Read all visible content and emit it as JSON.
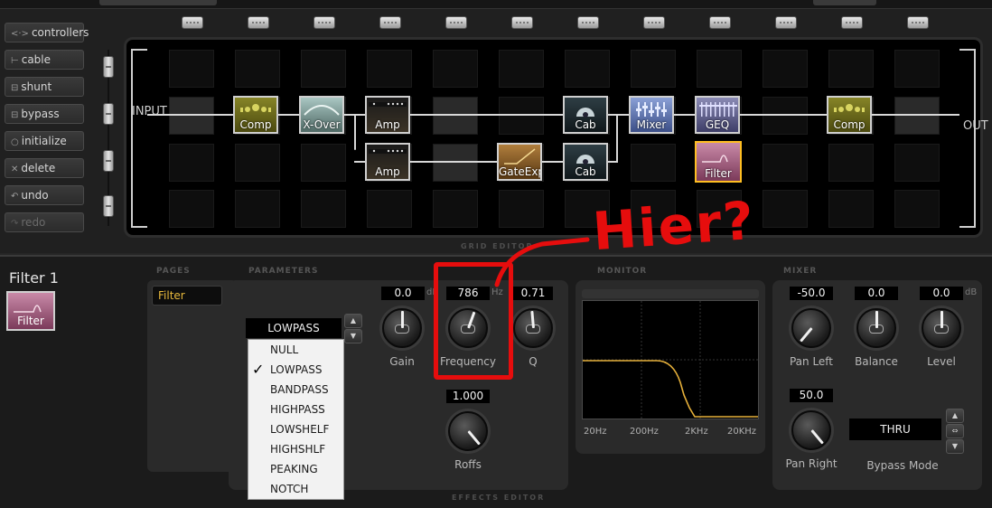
{
  "sidebar": {
    "buttons": [
      {
        "icon": "arrows-icon",
        "glyph": "<·>",
        "label": "controllers"
      },
      {
        "icon": "cable-icon",
        "glyph": "⊢",
        "label": "cable"
      },
      {
        "icon": "shunt-icon",
        "glyph": "⊟",
        "label": "shunt"
      },
      {
        "icon": "bypass-icon",
        "glyph": "⊟",
        "label": "bypass"
      },
      {
        "icon": "initialize-icon",
        "glyph": "○",
        "label": "initialize"
      },
      {
        "icon": "delete-icon",
        "glyph": "✕",
        "label": "delete"
      },
      {
        "icon": "undo-icon",
        "glyph": "↶",
        "label": "undo"
      },
      {
        "icon": "redo-icon",
        "glyph": "↷",
        "label": "redo"
      }
    ]
  },
  "grid": {
    "input_label": "INPUT",
    "output_label": "OUT",
    "section_label": "GRID EDITOR",
    "blocks": {
      "comp1": "Comp",
      "xover": "X-Over",
      "amp1": "Amp",
      "amp2": "Amp",
      "gateexp": "GateExp",
      "cab1": "Cab",
      "cab2": "Cab",
      "mixer": "Mixer",
      "geq": "GEQ",
      "filter": "Filter",
      "comp2": "Comp"
    }
  },
  "editor": {
    "section_label": "EFFECTS EDITOR",
    "block_name": "Filter 1",
    "block_icon_label": "Filter",
    "pages_label": "PAGES",
    "parameters_label": "PARAMETERS",
    "monitor_label": "MONITOR",
    "mixer_label": "MIXER",
    "page_tab": "Filter",
    "type_selected": "LOWPASS",
    "type_options": [
      "NULL",
      "LOWPASS",
      "BANDPASS",
      "HIGHPASS",
      "LOWSHELF",
      "HIGHSHLF",
      "PEAKING",
      "NOTCH"
    ],
    "checked_option_index": 1,
    "params": {
      "gain": {
        "label": "Gain",
        "value": "0.0",
        "unit": "dB"
      },
      "frequency": {
        "label": "Frequency",
        "value": "786",
        "unit": "Hz"
      },
      "q": {
        "label": "Q",
        "value": "0.71"
      },
      "roffs": {
        "label": "Roffs",
        "value": "1.000"
      }
    },
    "monitor": {
      "axis_labels": [
        "20Hz",
        "200Hz",
        "2KHz",
        "20KHz"
      ],
      "curve_color": "#e6b03a"
    },
    "mixer": {
      "pan_left": {
        "label": "Pan Left",
        "value": "-50.0"
      },
      "balance": {
        "label": "Balance",
        "value": "0.0"
      },
      "level": {
        "label": "Level",
        "value": "0.0",
        "unit": "dB"
      },
      "pan_right": {
        "label": "Pan Right",
        "value": "50.0"
      },
      "bypass_mode": {
        "label": "Bypass Mode",
        "value": "THRU"
      }
    }
  },
  "annotation": {
    "text": "Hier?",
    "color": "#e60d0d"
  }
}
